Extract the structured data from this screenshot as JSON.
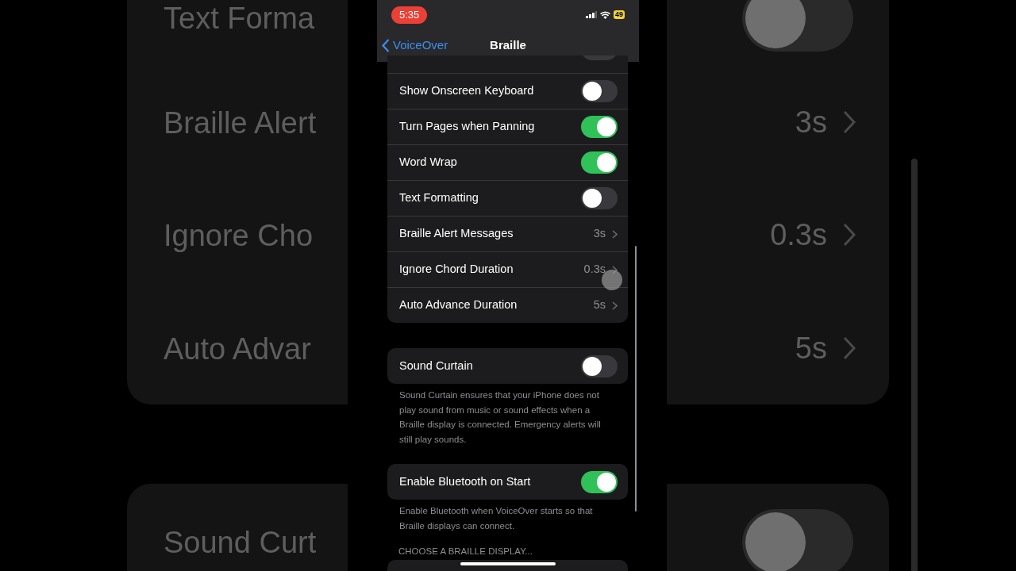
{
  "backdrop": {
    "left": [
      {
        "text": "Text Forma"
      },
      {
        "text": "Braille Alert"
      },
      {
        "text": "Ignore Cho"
      },
      {
        "text": "Auto Advar"
      },
      {
        "text": "Sound Curt"
      }
    ],
    "right": [
      {
        "kind": "toggle",
        "on": false
      },
      {
        "kind": "value",
        "text": "3s"
      },
      {
        "kind": "value",
        "text": "0.3s"
      },
      {
        "kind": "value",
        "text": "5s"
      },
      {
        "kind": "toggle",
        "on": false
      }
    ]
  },
  "status_bar": {
    "time": "5:35",
    "battery": "49"
  },
  "nav": {
    "back": "VoiceOver",
    "title": "Braille"
  },
  "groups": [
    {
      "rows": [
        {
          "kind": "toggle",
          "label": "Show Onscreen Keyboard",
          "on": false
        },
        {
          "kind": "toggle",
          "label": "Turn Pages when Panning",
          "on": true
        },
        {
          "kind": "toggle",
          "label": "Word Wrap",
          "on": true
        },
        {
          "kind": "toggle",
          "label": "Text Formatting",
          "on": false
        },
        {
          "kind": "link",
          "label": "Braille Alert Messages",
          "value": "3s"
        },
        {
          "kind": "link",
          "label": "Ignore Chord Duration",
          "value": "0.3s"
        },
        {
          "kind": "link",
          "label": "Auto Advance Duration",
          "value": "5s"
        }
      ]
    },
    {
      "rows": [
        {
          "kind": "toggle",
          "label": "Sound Curtain",
          "on": false
        }
      ],
      "footer": "Sound Curtain ensures that your iPhone does not play sound from music or sound effects when a Braille display is connected. Emergency alerts will still play sounds."
    },
    {
      "rows": [
        {
          "kind": "toggle",
          "label": "Enable Bluetooth on Start",
          "on": true
        }
      ],
      "footer": "Enable Bluetooth when VoiceOver starts so that Braille displays can connect."
    }
  ],
  "section_header": "CHOOSE A BRAILLE DISPLAY..."
}
